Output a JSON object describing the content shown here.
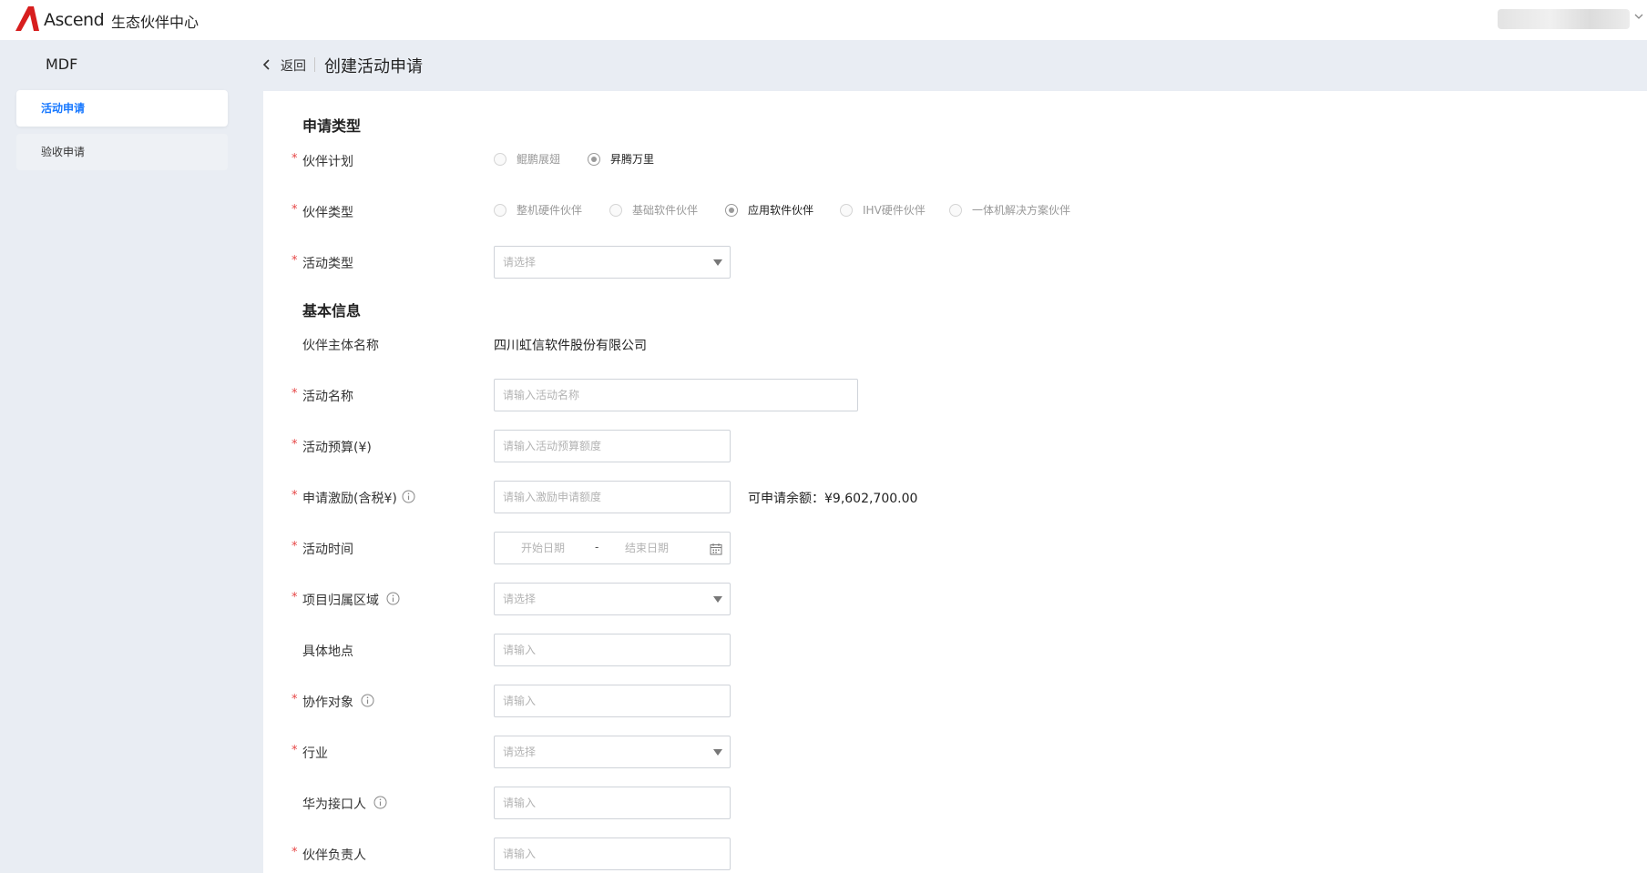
{
  "header": {
    "brand": "Ascend",
    "portal_title": "生态伙伴中心"
  },
  "sidebar": {
    "title": "MDF",
    "items": [
      {
        "label": "活动申请",
        "active": true
      },
      {
        "label": "验收申请",
        "active": false
      }
    ]
  },
  "page": {
    "back_label": "返回",
    "title": "创建活动申请"
  },
  "form": {
    "section_apply_type": "申请类型",
    "partner_plan": {
      "label": "伙伴计划",
      "required": true,
      "options": [
        "鲲鹏展翅",
        "昇腾万里"
      ],
      "selected": "昇腾万里"
    },
    "partner_type": {
      "label": "伙伴类型",
      "required": true,
      "options": [
        "整机硬件伙伴",
        "基础软件伙伴",
        "应用软件伙伴",
        "IHV硬件伙伴",
        "一体机解决方案伙伴"
      ],
      "selected": "应用软件伙伴"
    },
    "activity_type": {
      "label": "活动类型",
      "required": true,
      "placeholder": "请选择"
    },
    "section_basic_info": "基本信息",
    "partner_entity": {
      "label": "伙伴主体名称",
      "value": "四川虹信软件股份有限公司"
    },
    "activity_name": {
      "label": "活动名称",
      "required": true,
      "placeholder": "请输入活动名称"
    },
    "activity_budget": {
      "label": "活动预算(¥)",
      "required": true,
      "placeholder": "请输入活动预算额度"
    },
    "incentive": {
      "label": "申请激励(含税¥)",
      "required": true,
      "placeholder": "请输入激励申请额度",
      "balance_label": "可申请余额：",
      "balance_value": "¥9,602,700.00"
    },
    "activity_time": {
      "label": "活动时间",
      "required": true,
      "start_placeholder": "开始日期",
      "separator": "-",
      "end_placeholder": "结束日期"
    },
    "region": {
      "label": "项目归属区域",
      "required": true,
      "placeholder": "请选择"
    },
    "location": {
      "label": "具体地点",
      "required": false,
      "placeholder": "请输入"
    },
    "collaborator": {
      "label": "协作对象",
      "required": true,
      "placeholder": "请输入"
    },
    "industry": {
      "label": "行业",
      "required": true,
      "placeholder": "请选择"
    },
    "huawei_contact": {
      "label": "华为接口人",
      "required": false,
      "placeholder": "请输入"
    },
    "partner_owner": {
      "label": "伙伴负责人",
      "required": true,
      "placeholder": "请输入"
    },
    "required_mark": "*"
  },
  "colors": {
    "accent": "#1677ff",
    "required": "#e64545",
    "brand_red": "#d71e1e",
    "page_bg": "#e9edf3"
  }
}
